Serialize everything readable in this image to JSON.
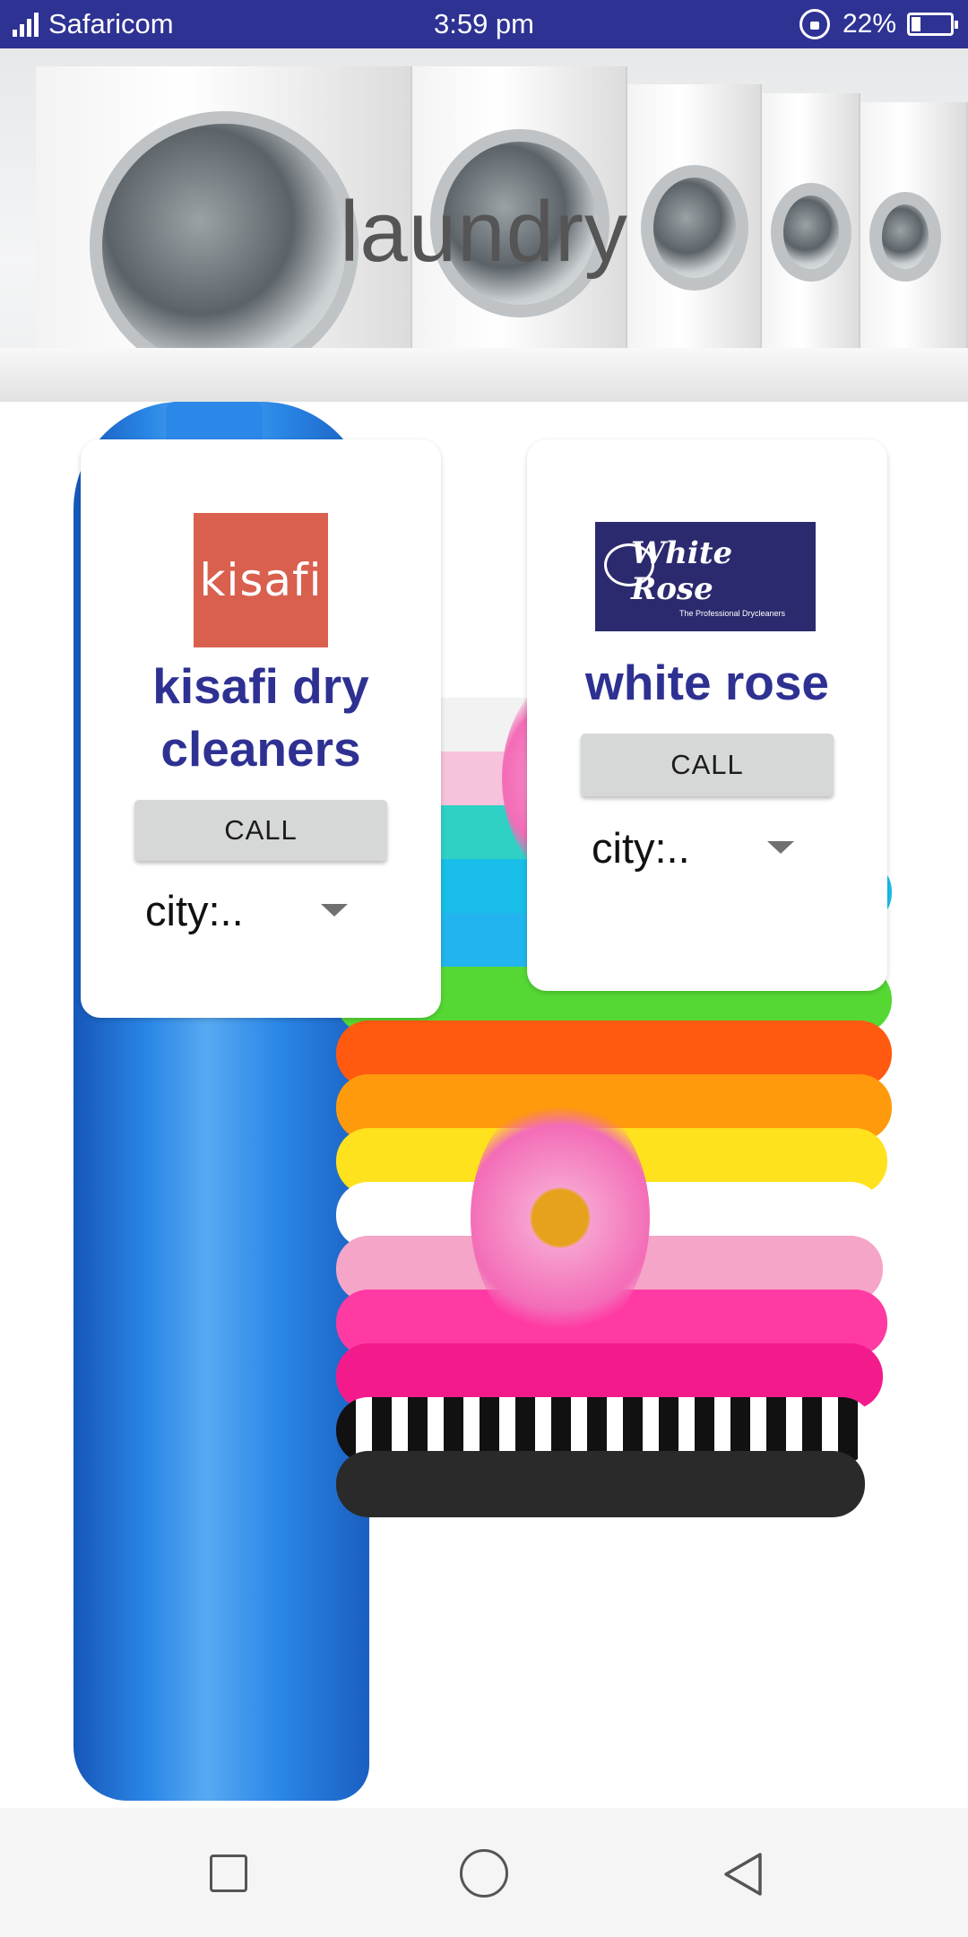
{
  "status_bar": {
    "carrier": "Safaricom",
    "time": "3:59 pm",
    "battery_percent": "22%",
    "icons": [
      "signal-icon",
      "rotation-lock-icon",
      "battery-icon"
    ]
  },
  "header": {
    "title": "laundry"
  },
  "cards": [
    {
      "logo_text": "kisafi",
      "name": "kisafi dry cleaners",
      "call_label": "CALL",
      "city_value": "city:.."
    },
    {
      "logo_text": "White Rose",
      "logo_subtext": "The Professional Drycleaners",
      "name": "white rose",
      "call_label": "CALL",
      "city_value": "city:.."
    }
  ],
  "colors": {
    "status_bar": "#2e3293",
    "card_title": "#2e3192",
    "kisafi_logo": "#d9604f",
    "white_rose_logo": "#2c2a6e",
    "button": "#d6d7d7"
  },
  "nav_bar": {
    "icons": [
      "recents-square-icon",
      "home-circle-icon",
      "back-triangle-icon"
    ]
  }
}
